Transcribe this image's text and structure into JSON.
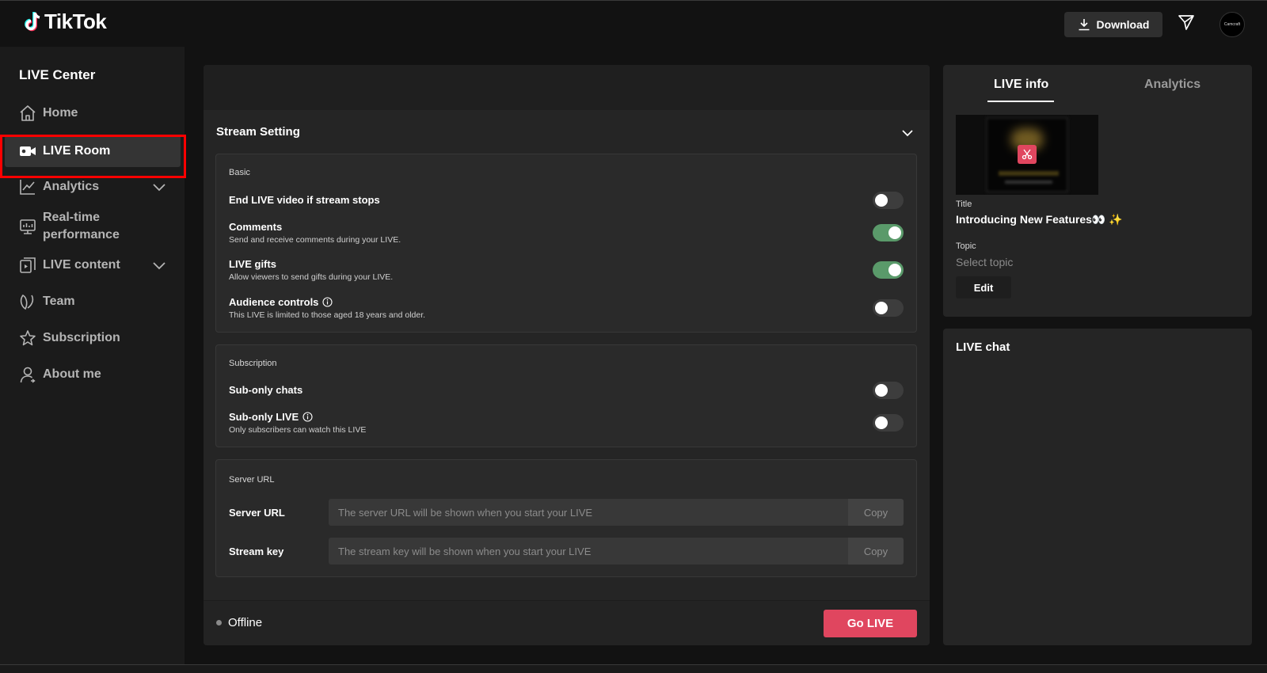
{
  "header": {
    "brand": "TikTok",
    "download_label": "Download",
    "avatar_text": "Camcraft"
  },
  "sidebar": {
    "title": "LIVE Center",
    "items": [
      {
        "label": "Home",
        "icon": "home-icon"
      },
      {
        "label": "LIVE Room",
        "icon": "video-camera-icon",
        "active": true
      },
      {
        "label": "Analytics",
        "icon": "chart-line-icon",
        "expandable": true
      },
      {
        "label": "Real-time performance",
        "line1": "Real-time",
        "line2": "performance",
        "icon": "monitor-icon"
      },
      {
        "label": "LIVE content",
        "icon": "content-stack-icon",
        "expandable": true
      },
      {
        "label": "Team",
        "icon": "team-icon"
      },
      {
        "label": "Subscription",
        "icon": "subscription-star-icon"
      },
      {
        "label": "About me",
        "icon": "user-icon"
      }
    ]
  },
  "stream_setting": {
    "title": "Stream Setting",
    "basic": {
      "title": "Basic",
      "rows": [
        {
          "label": "End LIVE video if stream stops",
          "sub": "",
          "on": false
        },
        {
          "label": "Comments",
          "sub": "Send and receive comments during your LIVE.",
          "on": true
        },
        {
          "label": "LIVE gifts",
          "sub": "Allow viewers to send gifts during your LIVE.",
          "on": true
        },
        {
          "label": "Audience controls",
          "sub": "This LIVE is limited to those aged 18 years and older.",
          "on": false
        }
      ]
    },
    "subscription": {
      "title": "Subscription",
      "rows": [
        {
          "label": "Sub-only chats",
          "sub": "",
          "on": false
        },
        {
          "label": "Sub-only LIVE",
          "sub": "Only subscribers can watch this LIVE",
          "on": false
        }
      ]
    },
    "server": {
      "title": "Server URL",
      "url_label": "Server URL",
      "url_placeholder": "The server URL will be shown when you start your LIVE",
      "key_label": "Stream key",
      "key_placeholder": "The stream key will be shown when you start your LIVE",
      "copy_label": "Copy"
    },
    "status": "Offline",
    "go_live_label": "Go LIVE"
  },
  "live_info": {
    "tabs": [
      "LIVE info",
      "Analytics"
    ],
    "title_label": "Title",
    "title_value": "Introducing New Features👀 ✨",
    "topic_label": "Topic",
    "topic_placeholder": "Select topic",
    "edit_label": "Edit"
  },
  "live_chat": {
    "title": "LIVE chat"
  },
  "colors": {
    "accent": "#e0465f",
    "toggle_on": "#5a9a6a",
    "highlight": "#ff0000"
  }
}
